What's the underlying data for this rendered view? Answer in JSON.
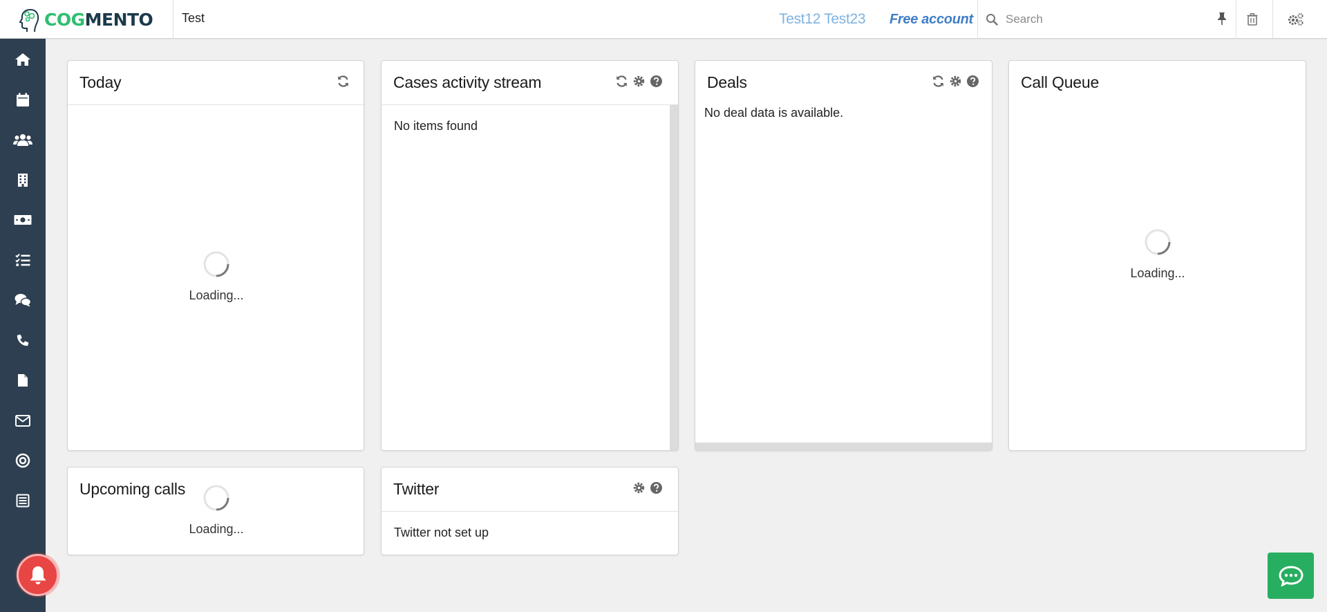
{
  "brand": {
    "logo_part1": "COG",
    "logo_part2": "MENTO"
  },
  "header": {
    "page_name": "Test",
    "user_name": "Test12 Test23",
    "account_type": "Free account",
    "search_placeholder": "Search"
  },
  "header_icons": [
    "search-icon",
    "pin-icon",
    "trash-icon",
    "settings-icon"
  ],
  "sidebar": {
    "items": [
      {
        "icon": "home-icon"
      },
      {
        "icon": "calendar-icon"
      },
      {
        "icon": "contacts-icon"
      },
      {
        "icon": "companies-icon"
      },
      {
        "icon": "deals-icon"
      },
      {
        "icon": "tasks-icon"
      },
      {
        "icon": "cases-icon"
      },
      {
        "icon": "calls-icon"
      },
      {
        "icon": "documents-icon"
      },
      {
        "icon": "email-icon"
      },
      {
        "icon": "campaigns-icon"
      },
      {
        "icon": "forms-icon"
      }
    ]
  },
  "cards": {
    "today": {
      "title": "Today",
      "loading": "Loading..."
    },
    "cases": {
      "title": "Cases activity stream",
      "empty": "No items found"
    },
    "deals": {
      "title": "Deals",
      "empty": "No deal data is available."
    },
    "call_queue": {
      "title": "Call Queue",
      "loading": "Loading..."
    },
    "upcoming_calls": {
      "title": "Upcoming calls",
      "loading": "Loading..."
    },
    "twitter": {
      "title": "Twitter",
      "empty": "Twitter not set up"
    }
  },
  "colors": {
    "sidebar_bg": "#2d3f50",
    "brand_green": "#2fbf71",
    "brand_dark": "#1c3a4a",
    "user_name": "#7fb3e1",
    "account_link": "#3f7ec7",
    "notification": "#e84545",
    "chat_button": "#27ae60",
    "page_bg": "#f0f0f0"
  }
}
